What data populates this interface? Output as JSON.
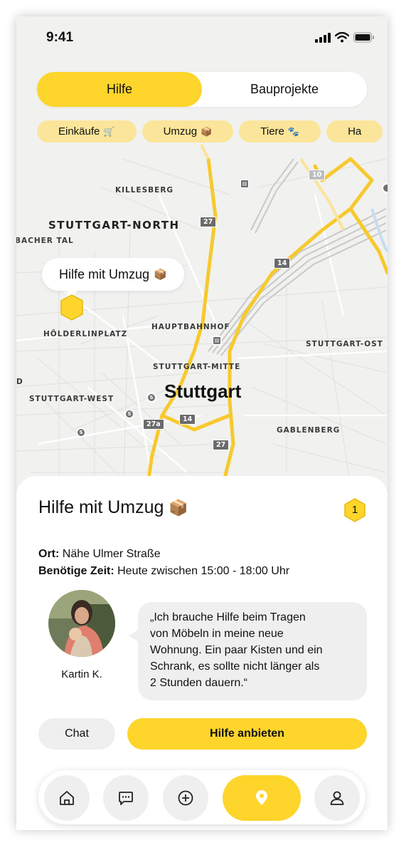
{
  "status_bar": {
    "time": "9:41"
  },
  "segmented": {
    "active_label": "Hilfe",
    "other_label": "Bauprojekte"
  },
  "chips": [
    {
      "label": "Einkäufe",
      "emoji": "🛒"
    },
    {
      "label": "Umzug",
      "emoji": "📦"
    },
    {
      "label": "Tiere",
      "emoji": "🐾"
    },
    {
      "label": "Ha",
      "emoji": ""
    }
  ],
  "map": {
    "labels": {
      "killesberg": "KILLESBERG",
      "stuttgart_north": "STUTTGART-NORTH",
      "bacher_tal": "BACHER TAL",
      "hoelderlinplatz": "HÖLDERLINPLATZ",
      "hauptbahnhof": "HAUPTBAHNHOF",
      "stuttgart_ost": "STUTTGART-OST",
      "stuttgart_mitte": "STUTTGART-MITTE",
      "stuttgart_west": "STUTTGART-WEST",
      "city": "Stuttgart",
      "gablenberg": "GABLENBERG",
      "d_edge": "D"
    },
    "road_shields": [
      "10",
      "27",
      "14",
      "14",
      "27a",
      "27"
    ],
    "bubble": {
      "text": "Hilfe mit Umzug",
      "emoji": "📦"
    }
  },
  "request": {
    "title": "Hilfe mit Umzug",
    "title_emoji": "📦",
    "badge_count": "1",
    "location_label": "Ort:",
    "location_value": "Nähe Ulmer Straße",
    "time_label": "Benötige Zeit:",
    "time_value": "Heute zwischen 15:00 - 18:00 Uhr",
    "quote_lines": [
      "„Ich brauche Hilfe beim Tragen",
      "von Möbeln in meine neue",
      "Wohnung. Ein paar Kisten und ein",
      "Schrank, es sollte nicht länger als",
      "2 Stunden dauern.“"
    ],
    "author": "Kartin K.",
    "chat_label": "Chat",
    "offer_label": "Hilfe anbieten"
  },
  "colors": {
    "accent": "#fdd52b",
    "chip": "#fbe59a",
    "road": "#f7c92d",
    "map_bg": "#f1f1ef"
  },
  "nav_icons": [
    "home-icon",
    "chat-icon",
    "add-icon",
    "map-pin-icon",
    "profile-icon"
  ]
}
